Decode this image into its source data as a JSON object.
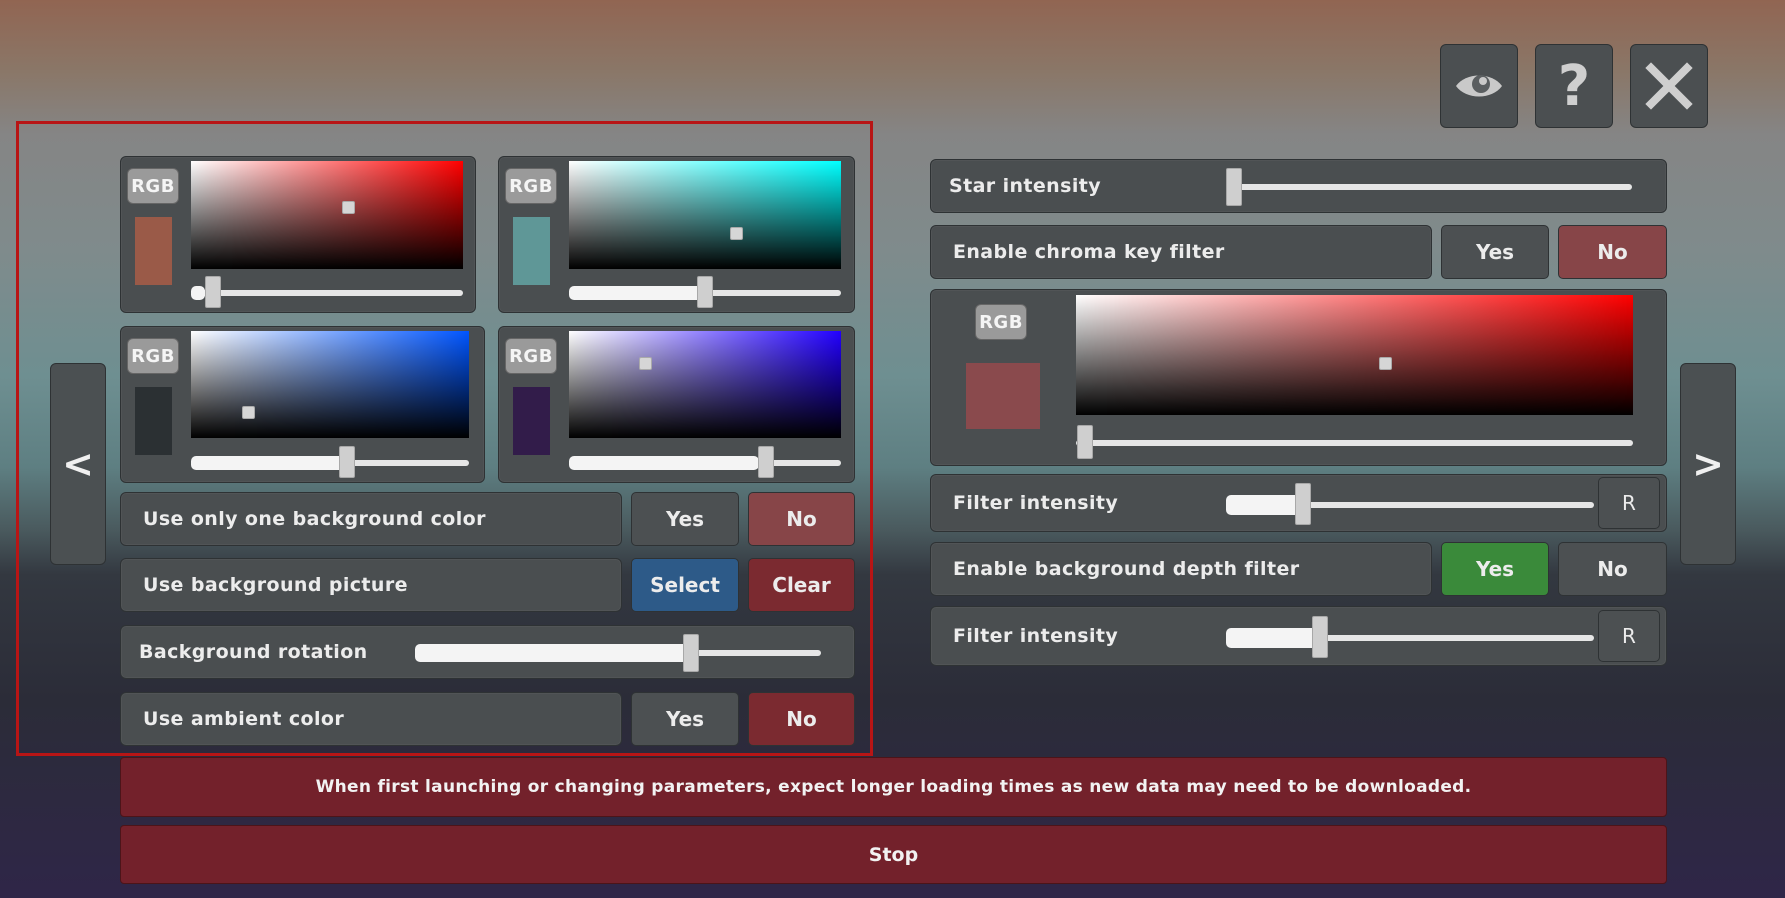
{
  "top_buttons": {
    "eye": "eye-icon",
    "help": "?",
    "close": "close-icon"
  },
  "nav": {
    "prev": "<",
    "next": ">"
  },
  "left": {
    "color_pickers": [
      {
        "rgb_label": "RGB",
        "swatch": "#9a5a48",
        "hue": "#ff0000"
      },
      {
        "rgb_label": "RGB",
        "swatch": "#5f9797",
        "hue": "#00ffff"
      },
      {
        "rgb_label": "RGB",
        "swatch": "#2b3033",
        "hue": "#0055ff"
      },
      {
        "rgb_label": "RGB",
        "swatch": "#321c4a",
        "hue": "#2200ff"
      }
    ],
    "one_bg_color": {
      "label": "Use only one background color",
      "yes": "Yes",
      "no": "No"
    },
    "bg_picture": {
      "label": "Use background picture",
      "select": "Select",
      "clear": "Clear"
    },
    "bg_rotation": {
      "label": "Background rotation",
      "value": 0.68
    },
    "ambient": {
      "label": "Use ambient color",
      "yes": "Yes",
      "no": "No"
    }
  },
  "right": {
    "star_intensity": {
      "label": "Star intensity",
      "value": 0.0
    },
    "chroma_key": {
      "label": "Enable chroma key filter",
      "yes": "Yes",
      "no": "No"
    },
    "chroma_picker": {
      "rgb_label": "RGB",
      "swatch": "#8a4a4d",
      "hue": "#ff0000"
    },
    "filter1": {
      "label": "Filter intensity",
      "reset": "R",
      "value": 0.21
    },
    "depth_filter": {
      "label": "Enable background depth filter",
      "yes": "Yes",
      "no": "No"
    },
    "filter2": {
      "label": "Filter intensity",
      "reset": "R",
      "value": 0.26
    }
  },
  "notice": "When first launching or changing parameters, expect longer loading times as new data may need to be downloaded.",
  "stop_label": "Stop"
}
